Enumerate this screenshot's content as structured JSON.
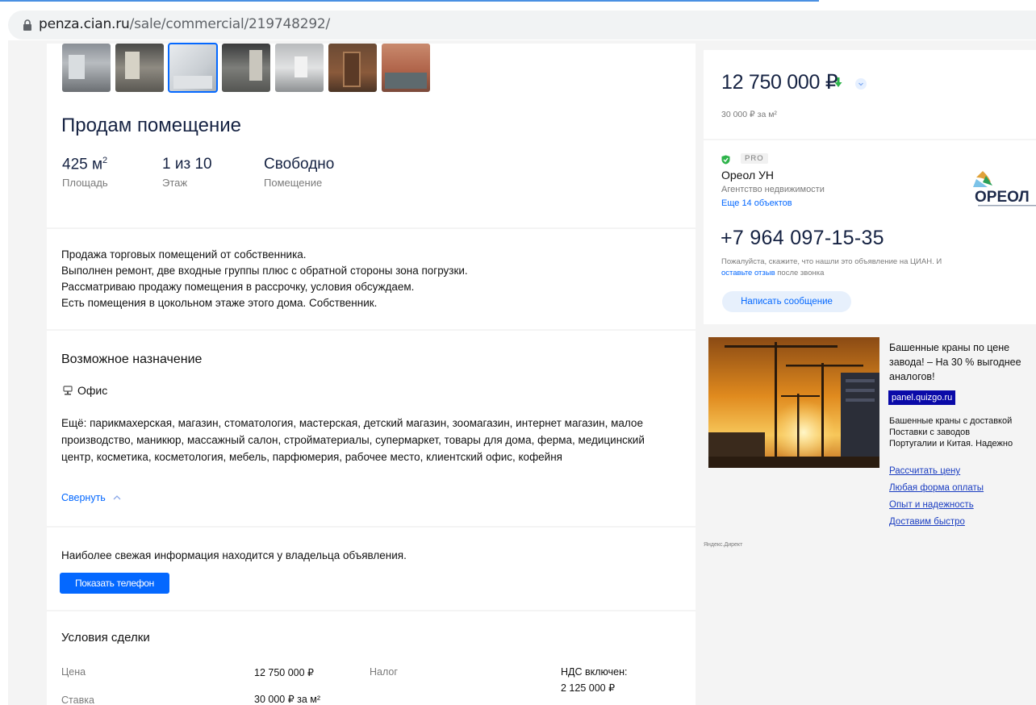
{
  "browser": {
    "url_host": "penza.cian.ru",
    "url_path": "/sale/commercial/219748292/"
  },
  "listing": {
    "title": "Продам помещение",
    "facts": [
      {
        "value": "425 м",
        "sup": "2",
        "label": "Площадь"
      },
      {
        "value": "1 из 10",
        "label": "Этаж"
      },
      {
        "value": "Свободно",
        "label": "Помещение"
      }
    ],
    "description": [
      "Продажа торговых помещений от собственника.",
      "Выполнен ремонт, две входные группы плюс с обратной стороны зона погрузки.",
      "Рассматриваю продажу помещения в рассрочку, условия обсуждаем.",
      "Есть помещения в цокольном этаже этого дома. Собственник."
    ]
  },
  "purpose": {
    "heading": "Возможное назначение",
    "primary": "Офис",
    "more": "Ещё: парикмахерская, магазин, стоматология, мастерская, детский магазин, зоомагазин, интернет магазин, малое производство, маникюр, массажный салон, стройматериалы, супермаркет, товары для дома, ферма, медицинский центр, косметика, косметология, мебель, парфюмерия, рабочее место, клиентский офис, кофейня",
    "collapse": "Свернуть"
  },
  "owner_block": {
    "note": "Наиболее свежая информация находится у владельца объявления.",
    "button": "Показать телефон"
  },
  "terms": {
    "heading": "Условия сделки",
    "price_label": "Цена",
    "price_value": "12 750 000 ₽",
    "tax_label": "Налог",
    "tax_value_1": "НДС включен:",
    "tax_value_2": "2 125 000 ₽",
    "rate_label": "Ставка",
    "rate_value": "30 000 ₽ за м²"
  },
  "sidebar": {
    "price": "12 750 000 ₽",
    "price_per_m2": "30 000 ₽ за м²",
    "pro": "PRO",
    "agency_name": "Ореол УН",
    "agency_type": "Агентство недвижимости",
    "agency_more": "Еще 14 объектов",
    "logo_text": "ОРЕОЛ",
    "phone": "+7 964 097-15-35",
    "phone_note_1": "Пожалуйста, скажите, что нашли это объявление на ЦИАН. И ",
    "phone_note_link": "оставьте отзыв",
    "phone_note_2": " после звонка",
    "message_button": "Написать сообщение"
  },
  "ad": {
    "title": "Башенные краны по цене завода! – На 30 % выгоднее аналогов!",
    "domain": "panel.quizgo.ru",
    "text_1": "Башенные краны с доставкой",
    "text_2": "Поставки с заводов",
    "text_3": "Португалии и Китая. Надежно",
    "links": [
      "Рассчитать цену",
      "Любая форма оплаты",
      "Опыт и надежность",
      "Доставим быстро"
    ],
    "label": "Яндекс.Директ"
  },
  "colors": {
    "accent": "#0468ff",
    "title": "#152242",
    "price_down": "#2db34a"
  }
}
